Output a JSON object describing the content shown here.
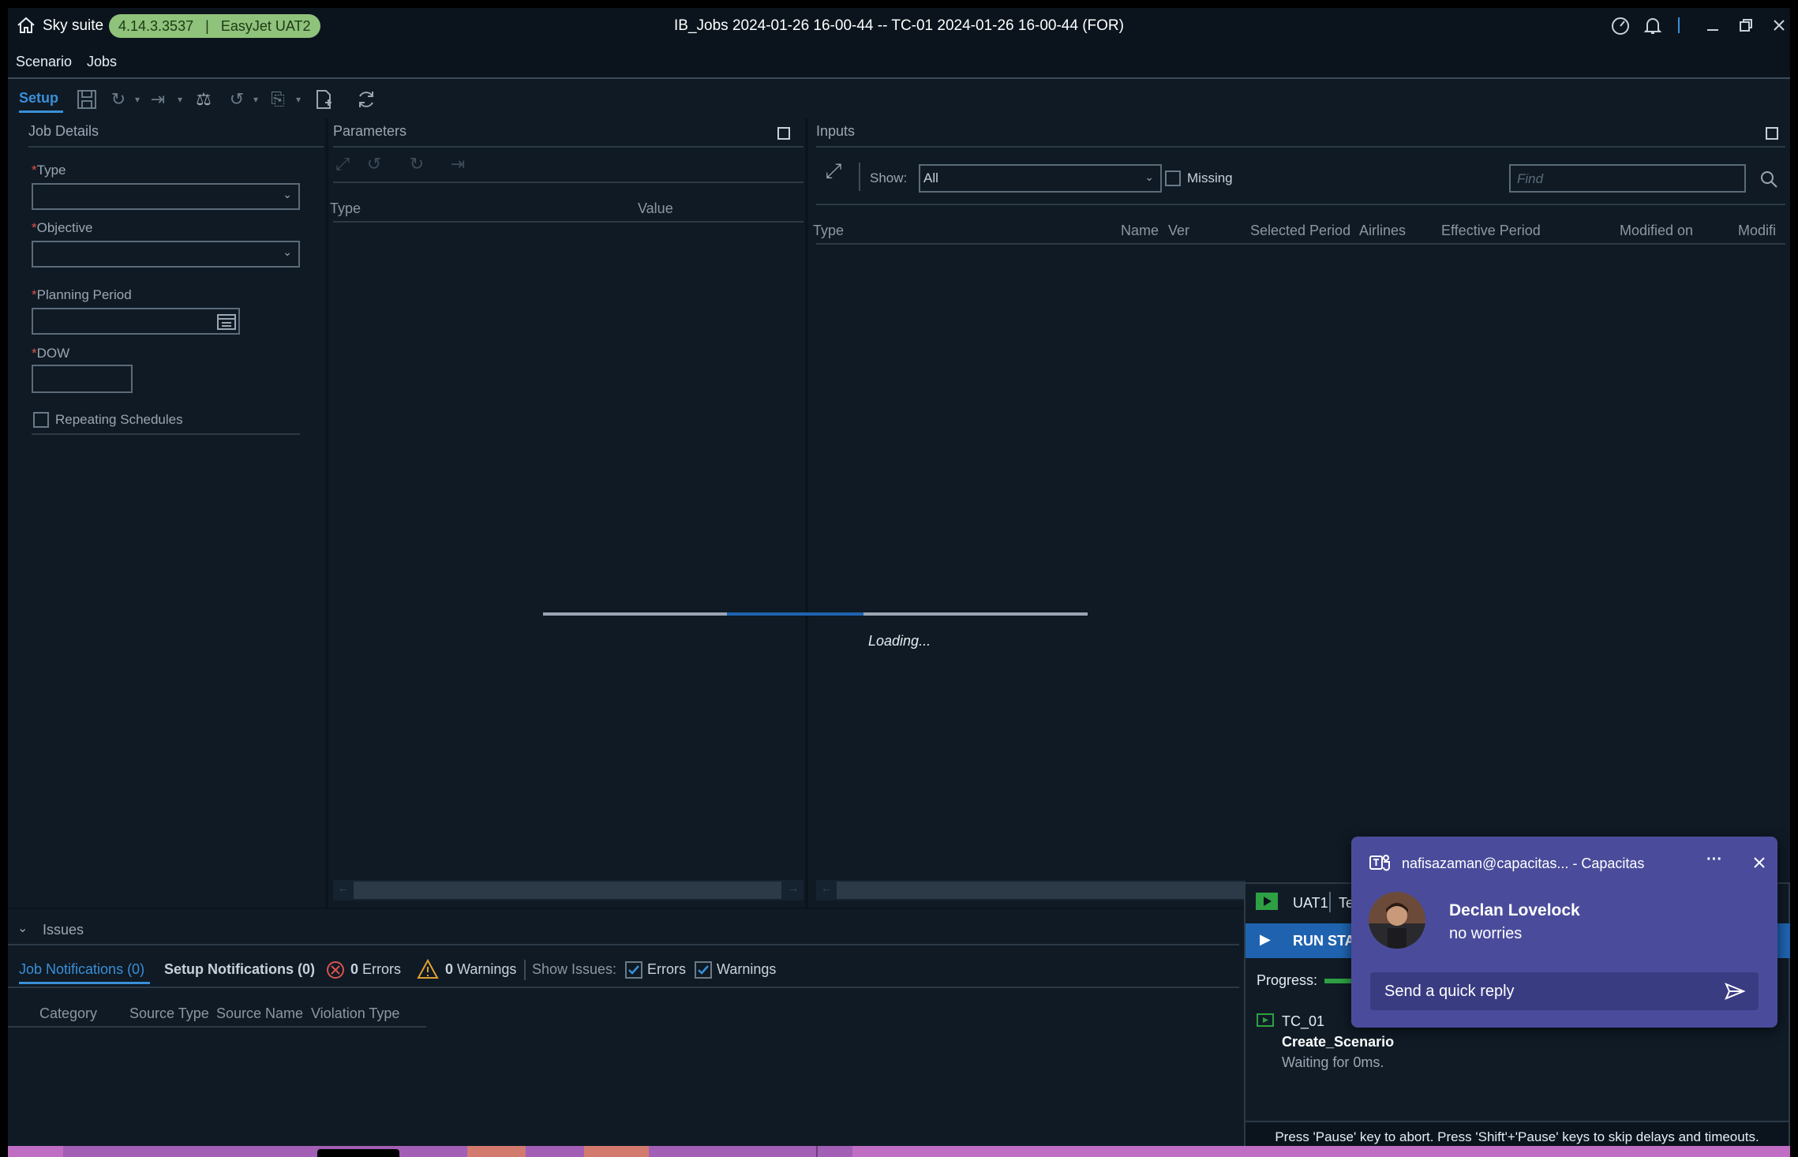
{
  "app": {
    "name": "Sky suite",
    "version": "4.14.3.3537",
    "environment": "EasyJet UAT2",
    "window_title": "IB_Jobs 2024-01-26 16-00-44 -- TC-01 2024-01-26 16-00-44 (FOR)"
  },
  "menu": {
    "scenario": "Scenario",
    "jobs": "Jobs"
  },
  "toolbar": {
    "setup_tab": "Setup"
  },
  "job_details": {
    "title": "Job Details",
    "type_label": "Type",
    "objective_label": "Objective",
    "planning_period_label": "Planning Period",
    "dow_label": "DOW",
    "repeating_label": "Repeating Schedules",
    "required_mark": "*"
  },
  "parameters": {
    "title": "Parameters",
    "columns": [
      "Type",
      "Value"
    ]
  },
  "inputs": {
    "title": "Inputs",
    "show_label": "Show:",
    "show_value": "All",
    "missing_label": "Missing",
    "find_placeholder": "Find",
    "columns": [
      "Type",
      "Name",
      "Ver",
      "Selected Period",
      "Airlines",
      "Effective Period",
      "Modified on",
      "Modifi"
    ]
  },
  "loading": {
    "text": "Loading...",
    "progress": 0.45
  },
  "issues": {
    "title": "Issues",
    "job_notifications": "Job Notifications (0)",
    "setup_notifications": "Setup Notifications (0)",
    "errors_count": "0",
    "errors_label": "Errors",
    "warnings_count": "0",
    "warnings_label": "Warnings",
    "show_issues_label": "Show Issues:",
    "filter_errors": "Errors",
    "filter_warnings": "Warnings",
    "columns": [
      "Category",
      "Source Type",
      "Source Name",
      "Violation Type"
    ]
  },
  "runner": {
    "env": "UAT1",
    "env_suffix": "Tes",
    "run_button": "RUN STATI",
    "progress_label": "Progress:",
    "test_case": "TC_01",
    "step": "Create_Scenario",
    "status": "Waiting for 0ms.",
    "footer": "Press 'Pause' key to abort. Press 'Shift'+'Pause' keys to skip delays and timeouts."
  },
  "teams": {
    "account": "nafisazaman@capacitas... - Capacitas",
    "more": "···",
    "sender": "Declan Lovelock",
    "message": "no worries",
    "reply_placeholder": "Send a quick reply"
  },
  "colors": {
    "accent": "#3a8fd8",
    "badge": "#8fc27b",
    "teams": "#4a4c9b",
    "error": "#d9534f",
    "warning": "#e0a030",
    "runner_green": "#2ea043"
  }
}
